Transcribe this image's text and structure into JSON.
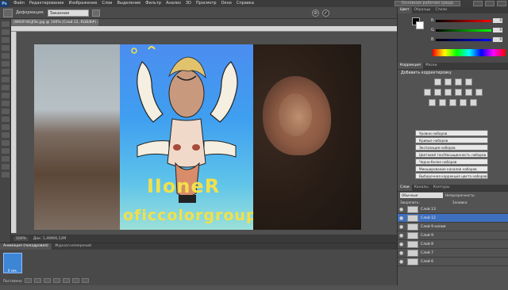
{
  "menubar": {
    "logo": "Ps",
    "items": [
      "Файл",
      "Редактирование",
      "Изображение",
      "Слои",
      "Выделение",
      "Фильтр",
      "Анализ",
      "3D",
      "Просмотр",
      "Окно",
      "Справка"
    ],
    "workspace": "Основная рабочая среда"
  },
  "options": {
    "label": "Деформация:",
    "mode": "Заказная"
  },
  "document": {
    "tab_title": "(W6VFr6GJf3k.jpg @ 100% (Слой 12, RGB/8#) ×",
    "zoom": "100%",
    "doc_info": "Док: 1,46M/6,12M"
  },
  "drawing": {
    "line1": "IIoneR",
    "line2": "oficcolorgroup"
  },
  "panels": {
    "color_tabs": [
      "Цвет",
      "Образцы",
      "Стили"
    ],
    "channels": [
      {
        "name": "R",
        "value": "0"
      },
      {
        "name": "G",
        "value": "0"
      },
      {
        "name": "B",
        "value": "0"
      }
    ],
    "adjust_tabs": [
      "Коррекция",
      "Маски"
    ],
    "adjust_title": "Добавить корректировку",
    "presets": [
      "Уровни наборов",
      "Кривые наборов",
      "Экспозиция наборов",
      "Цветовой тон/Насыщенность наборов",
      "Черно-белое наборов",
      "Микширование каналов наборов",
      "Выборочная коррекция цвета наборов"
    ],
    "layer_tabs": [
      "Слои",
      "Каналы",
      "Контуры"
    ],
    "blend_mode": "Обычные",
    "opacity_label": "Непрозрачность:",
    "lock_label": "Закрепить:",
    "fill_label": "Заливка:",
    "layers": [
      {
        "name": "Слой 13",
        "active": false
      },
      {
        "name": "Слой 12",
        "active": true
      },
      {
        "name": "Слой 9 копия",
        "active": false
      },
      {
        "name": "Слой 9",
        "active": false
      },
      {
        "name": "Слой 8",
        "active": false
      },
      {
        "name": "Слой 7",
        "active": false
      },
      {
        "name": "Слой 6",
        "active": false
      }
    ]
  },
  "bottom": {
    "tabs": [
      "Анимация (покадровая)",
      "Журнал измерений"
    ],
    "frame_label": "0 сек.",
    "loop": "Постоянно"
  }
}
